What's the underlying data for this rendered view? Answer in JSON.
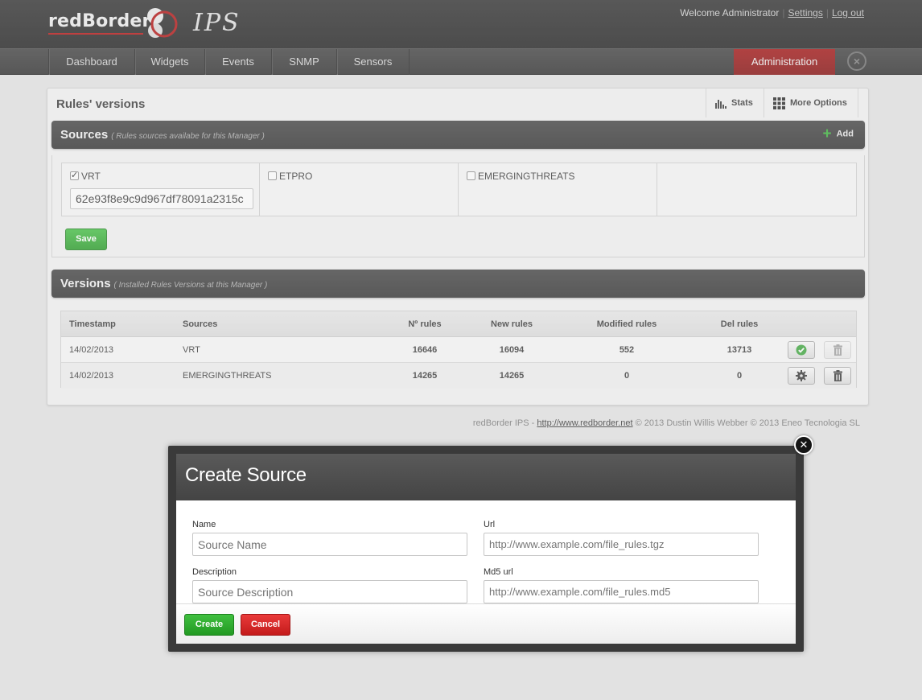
{
  "header": {
    "brand": "redBorder",
    "product": "IPS",
    "welcome": "Welcome Administrator",
    "settings_link": "Settings",
    "logout_link": "Log out"
  },
  "nav": {
    "items": [
      {
        "label": "Dashboard"
      },
      {
        "label": "Widgets"
      },
      {
        "label": "Events"
      },
      {
        "label": "SNMP"
      },
      {
        "label": "Sensors"
      }
    ],
    "active": "Administration",
    "close_icon": "close-icon"
  },
  "panel": {
    "title": "Rules' versions",
    "stats_label": "Stats",
    "more_options_label": "More Options"
  },
  "sources": {
    "title": "Sources",
    "subtitle": "( Rules sources availabe for this Manager )",
    "add_label": "Add",
    "items": [
      {
        "name": "VRT",
        "checked": true,
        "key": "62e93f8e9c9d967df78091a2315c"
      },
      {
        "name": "ETPRO",
        "checked": false
      },
      {
        "name": "EMERGINGTHREATS",
        "checked": false
      }
    ],
    "save_label": "Save"
  },
  "versions": {
    "title": "Versions",
    "subtitle": "( Installed Rules Versions at this Manager )",
    "columns": [
      "Timestamp",
      "Sources",
      "Nº rules",
      "New rules",
      "Modified rules",
      "Del rules"
    ],
    "rows": [
      {
        "timestamp": "14/02/2013",
        "sources": "VRT",
        "n_rules": "16646",
        "new_rules": "16094",
        "modified_rules": "552",
        "del_rules": "13713",
        "action_icon": "check-icon"
      },
      {
        "timestamp": "14/02/2013",
        "sources": "EMERGINGTHREATS",
        "n_rules": "14265",
        "new_rules": "14265",
        "modified_rules": "0",
        "del_rules": "0",
        "action_icon": "gear-icon"
      }
    ]
  },
  "footer": {
    "prefix": "redBorder IPS - ",
    "link": "http://www.redborder.net",
    "suffix": " © 2013 Dustin Willis Webber © 2013 Eneo Tecnologia SL"
  },
  "modal": {
    "title": "Create Source",
    "name_label": "Name",
    "name_placeholder": "Source Name",
    "url_label": "Url",
    "url_placeholder": "http://www.example.com/file_rules.tgz",
    "description_label": "Description",
    "description_placeholder": "Source Description",
    "md5_label": "Md5 url",
    "md5_placeholder": "http://www.example.com/file_rules.md5",
    "create_label": "Create",
    "cancel_label": "Cancel"
  },
  "colors": {
    "accent_red": "#8f0b0b",
    "green_button": "#2eab2e",
    "red_button": "#d42525",
    "header_bg": "#222222"
  }
}
